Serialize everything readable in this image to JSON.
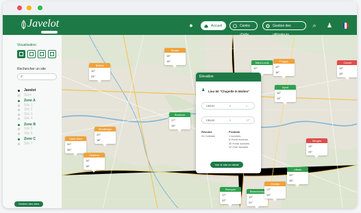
{
  "app": {
    "logo": "Javelot"
  },
  "header": {
    "nav": [
      {
        "label": "Accueil",
        "active": true
      },
      {
        "label": "Centre d'aide",
        "active": false
      },
      {
        "label": "Gestion des utilisateurs",
        "active": false
      }
    ]
  },
  "sidebar": {
    "title": "Visualisation",
    "search_title": "Rechercher un site",
    "tree": [
      {
        "label": "Javelot",
        "level": 0,
        "color": "#222222"
      },
      {
        "label": "Silos",
        "level": 1
      },
      {
        "label": "Zone A",
        "level": 0,
        "color": "#1d7a47"
      },
      {
        "label": "Silo 1",
        "level": 1
      },
      {
        "label": "Silo 2",
        "level": 1
      },
      {
        "label": "Silo 3",
        "level": 1
      },
      {
        "label": "Silo 4",
        "level": 1
      },
      {
        "label": "Zone B",
        "level": 0,
        "color": "#1d7a47"
      },
      {
        "label": "Silo 5",
        "level": 1
      },
      {
        "label": "Silo 6",
        "level": 1
      },
      {
        "label": "Zone C",
        "level": 0,
        "color": "#1d7a47"
      },
      {
        "label": "Silo 7",
        "level": 1
      }
    ],
    "bottom_button": "Gestion des silos"
  },
  "map": {
    "markers": [
      {
        "name": "Belfort",
        "color": "#f0a23a",
        "l1": "10°",
        "l2": "24°"
      },
      {
        "name": "Besan",
        "color": "#f0a23a",
        "l1": "15°",
        "l2": "15°"
      },
      {
        "name": "Saint-Louis",
        "color": "#2fa24f",
        "l1": "12°",
        "l2": ""
      },
      {
        "name": "Forges",
        "color": "#f0a23a",
        "l1": "12°",
        "l2": "18°"
      },
      {
        "name": "Carnet",
        "color": "#e14b4b",
        "l1": "15°",
        "l2": "15°"
      },
      {
        "name": "Aynd",
        "color": "#2fa24f",
        "l1": "16°",
        "l2": "14°"
      },
      {
        "name": "Bourbon",
        "color": "#2fa24f",
        "l1": "17°",
        "l2": "15°"
      },
      {
        "name": "Montbeige",
        "color": "#f0a23a",
        "l1": "22°",
        "l2": "18°"
      },
      {
        "name": "Saint-Sam",
        "color": "#f0a23a",
        "l1": "20°",
        "l2": "28°"
      },
      {
        "name": "Chateau",
        "color": "#f0a23a",
        "l1": "14°",
        "l2": "18°"
      },
      {
        "name": "Morges",
        "color": "#e14b4b",
        "l1": "13°",
        "l2": "24°"
      },
      {
        "name": "Lithais",
        "color": "#2fa24f",
        "l1": "20°",
        "l2": "18°"
      },
      {
        "name": "Ronquin",
        "color": "#2fa24f",
        "l1": "17°",
        "l2": "22°"
      },
      {
        "name": "Beauchamp",
        "color": "#2fa24f",
        "l1": "13°",
        "l2": "21°"
      },
      {
        "name": "Granby",
        "color": "#f0a23a",
        "l1": "17°",
        "l2": "19°"
      }
    ],
    "popup": {
      "header": "Elevation",
      "title": "Lieu 50 \"Chapelle le Moltes\"",
      "rows": [
        {
          "id": "CB101",
          "v1": "8",
          "v2": "1"
        },
        {
          "id": "CB102",
          "v1": "0",
          "v2": "17°"
        }
      ],
      "col1_title": "Résumé",
      "col1_value": "24 Cellules",
      "col2_title": "Produits",
      "col2_lines": [
        "1 Avoines",
        "6 Hordi avoines",
        "30 Hordi avoines",
        "12 Fluir avoines"
      ],
      "button": "Voir le site en détail"
    }
  }
}
